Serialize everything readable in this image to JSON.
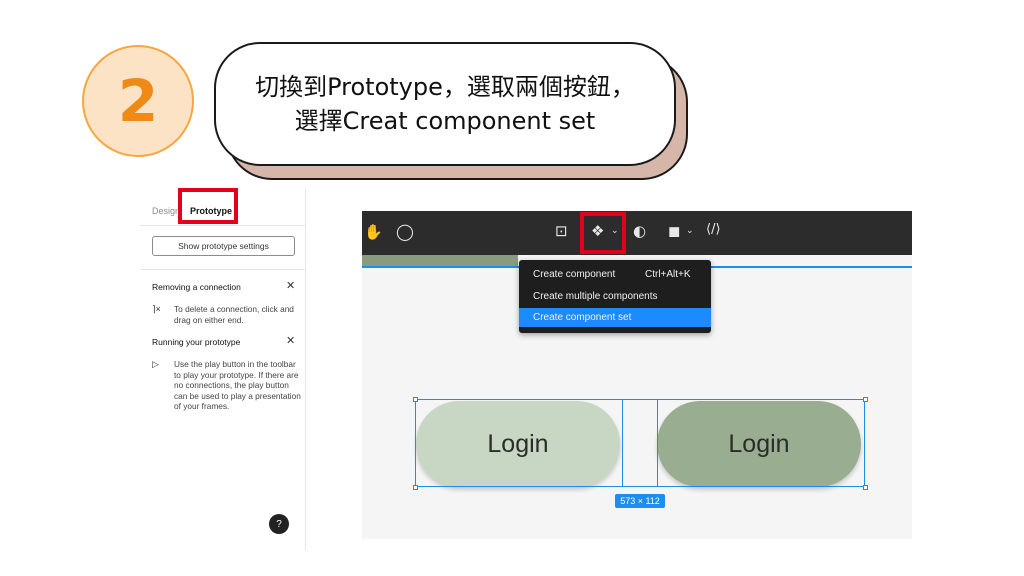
{
  "step": {
    "number": "2"
  },
  "callout": {
    "line1": "切換到Prototype，選取兩個按鈕，",
    "line2": "選擇Creat component set"
  },
  "left_panel": {
    "tabs": [
      {
        "label": "Design",
        "active": false
      },
      {
        "label": "Prototype",
        "active": true
      }
    ],
    "show_settings_label": "Show prototype settings",
    "sections": [
      {
        "title": "Removing a connection",
        "icon": "disconnect-icon",
        "text": "To delete a connection, click and drag on either end."
      },
      {
        "title": "Running your prototype",
        "icon": "play-icon",
        "text": "Use the play button in the toolbar to play your prototype. If there are no connections, the play button can be used to play a presentation of your frames."
      }
    ],
    "help_label": "?"
  },
  "toolbar": {
    "icons": [
      "hand-icon",
      "comment-icon",
      "frame-icon",
      "component-icon",
      "contrast-icon",
      "boolean-icon",
      "code-icon"
    ]
  },
  "dropdown": {
    "items": [
      {
        "label": "Create component",
        "shortcut": "Ctrl+Alt+K",
        "highlighted": false
      },
      {
        "label": "Create multiple components",
        "shortcut": "",
        "highlighted": false
      },
      {
        "label": "Create component set",
        "shortcut": "",
        "highlighted": true
      }
    ]
  },
  "canvas": {
    "buttons": [
      {
        "label": "Login",
        "color": "#c7d7c4"
      },
      {
        "label": "Login",
        "color": "#99ad90"
      }
    ],
    "selection_size": "573 × 112"
  },
  "colors": {
    "highlight_red": "#e3001b",
    "accent_orange": "#ef8a17",
    "selection_blue": "#1c8ef0",
    "toolbar_bg": "#2c2c2c"
  }
}
